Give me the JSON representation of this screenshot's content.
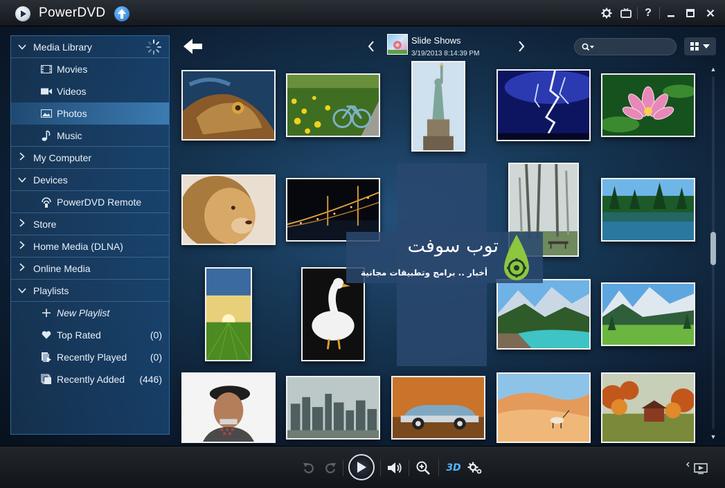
{
  "app": {
    "title": "PowerDVD"
  },
  "titlebar": {
    "settings_icon": "gear-icon",
    "tv_icon": "tv-mode-icon",
    "help_label": "?",
    "minimize_icon": "minimize-icon",
    "maximize_icon": "maximize-icon",
    "close_icon": "close-icon"
  },
  "sidebar": {
    "items": [
      {
        "label": "Media Library",
        "type": "section",
        "expanded": true,
        "icon": "chevron-down-icon"
      },
      {
        "label": "Movies",
        "type": "sub",
        "icon": "film-icon"
      },
      {
        "label": "Videos",
        "type": "sub",
        "icon": "video-camera-icon"
      },
      {
        "label": "Photos",
        "type": "sub",
        "icon": "photo-icon",
        "selected": true
      },
      {
        "label": "Music",
        "type": "sub",
        "icon": "music-note-icon"
      },
      {
        "label": "My Computer",
        "type": "section",
        "expanded": false,
        "icon": "chevron-right-icon"
      },
      {
        "label": "Devices",
        "type": "section",
        "expanded": true,
        "icon": "chevron-down-icon"
      },
      {
        "label": "PowerDVD Remote",
        "type": "sub",
        "icon": "remote-wifi-icon"
      },
      {
        "label": "Store",
        "type": "section",
        "expanded": false,
        "icon": "chevron-right-icon"
      },
      {
        "label": "Home Media (DLNA)",
        "type": "section",
        "expanded": false,
        "icon": "chevron-right-icon"
      },
      {
        "label": "Online Media",
        "type": "section",
        "expanded": false,
        "icon": "chevron-right-icon"
      },
      {
        "label": "Playlists",
        "type": "section",
        "expanded": true,
        "icon": "chevron-down-icon"
      },
      {
        "label": "New Playlist",
        "type": "sub",
        "icon": "plus-icon"
      },
      {
        "label": "Top Rated",
        "type": "sub",
        "icon": "heart-icon",
        "count": "(0)"
      },
      {
        "label": "Recently Played",
        "type": "sub",
        "icon": "recently-played-icon",
        "count": "(0)"
      },
      {
        "label": "Recently Added",
        "type": "sub",
        "icon": "recently-added-icon",
        "count": "(446)"
      }
    ]
  },
  "content": {
    "album_title": "Slide Shows",
    "album_date": "3/19/2013 8:14:39 PM",
    "search": {
      "placeholder": "",
      "value": ""
    }
  },
  "photos": [
    "iguana",
    "bicycle-field",
    "statue-of-liberty",
    "lightning",
    "lotus-flower",
    "lion",
    "bridge-night",
    "foggy-trees",
    "lake-forest",
    "sunset-field",
    "goose",
    "mountain-lake",
    "mountain-valley",
    "old-man",
    "city-skyline",
    "classic-car",
    "desert-oryx",
    "autumn-barn"
  ],
  "watermark": {
    "title": "توب سوفت",
    "subtitle": "أخبار .. برامج وتطبيقات مجانية"
  },
  "bottombar": {
    "controls": [
      "undo-icon",
      "redo-icon",
      "play-icon",
      "volume-icon",
      "zoom-in-icon",
      "3d-icon",
      "settings-gears-icon",
      "display-mode-icon"
    ],
    "three_d_label": "3D"
  },
  "colors": {
    "accent": "#1d6fc6",
    "sidebar_select": "#5aa9eb",
    "background": "#163653"
  }
}
